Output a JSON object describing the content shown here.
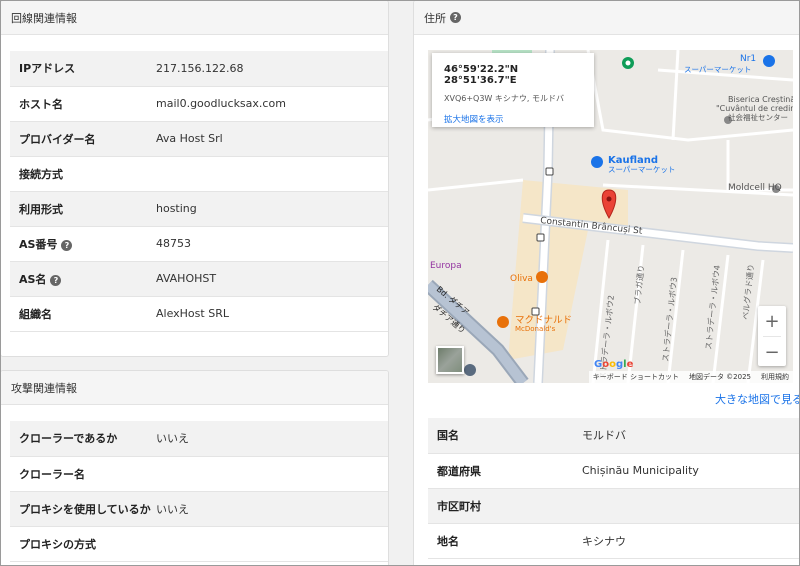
{
  "left_panel": {
    "title": "回線関連情報",
    "rows": [
      {
        "key": "IPアドレス",
        "value": "217.156.122.68",
        "help": false
      },
      {
        "key": "ホスト名",
        "value": "mail0.goodlucksax.com",
        "help": false
      },
      {
        "key": "プロバイダー名",
        "value": "Ava Host Srl",
        "help": false
      },
      {
        "key": "接続方式",
        "value": "",
        "help": false
      },
      {
        "key": "利用形式",
        "value": "hosting",
        "help": false
      },
      {
        "key": "AS番号",
        "value": "48753",
        "help": true
      },
      {
        "key": "AS名",
        "value": "AVAHOHST",
        "help": true
      },
      {
        "key": "組織名",
        "value": "AlexHost SRL",
        "help": false
      }
    ]
  },
  "attack_panel": {
    "title": "攻撃関連情報",
    "rows": [
      {
        "key": "クローラーであるか",
        "value": "いいえ"
      },
      {
        "key": "クローラー名",
        "value": ""
      },
      {
        "key": "プロキシを使用しているか",
        "value": "いいえ"
      },
      {
        "key": "プロキシの方式",
        "value": ""
      }
    ]
  },
  "address_panel": {
    "title": "住所",
    "map": {
      "coordinates": "46°59'22.2\"N 28°51'36.7\"E",
      "plus_code": "XVQ6+Q3W キシナウ, モルドバ",
      "enlarge_link": "拡大地図を表示",
      "zoom_in": "+",
      "zoom_out": "−",
      "google": "Google",
      "attribution": {
        "shortcuts": "キーボード ショートカット",
        "data": "地図データ ©2025",
        "terms": "利用規約"
      },
      "labels": {
        "street": "Constantin Brâncuși St",
        "kaufland": "Kaufland",
        "kaufland_sub": "スーパーマーケット",
        "nr1": "Nr1",
        "nr1_sub": "スーパーマーケット",
        "church1": "Biserica Creștină",
        "church2": "\"Cuvântul de credință\"",
        "church3": "社会福祉センター",
        "moldcell": "Moldcell HQ",
        "europa": "Europa",
        "oliva": "Oliva",
        "mcd": "マクドナルド",
        "mcd_en": "McDonald's",
        "dacia1": "Bd. ダチア",
        "dacia2": "ダチア通り",
        "st1": "ストラデーラ・ルボウ2",
        "st2": "ブラガ通り",
        "st3": "ストラデーラ・ルボウ3",
        "st4": "ストラデーラ・ルボウ4",
        "st5": "ベルグラド通り"
      },
      "colors": {
        "pin": "#ea4335",
        "link": "#1a73e8",
        "poi_blue": "#1a73e8",
        "poi_orange": "#e8710a",
        "poi_green": "#0f9d58"
      }
    },
    "bigger_map_link": "大きな地図で見る",
    "rows": [
      {
        "key": "国名",
        "value": "モルドバ"
      },
      {
        "key": "都道府県",
        "value": "Chișinău Municipality"
      },
      {
        "key": "市区町村",
        "value": ""
      },
      {
        "key": "地名",
        "value": "キシナウ"
      }
    ]
  }
}
